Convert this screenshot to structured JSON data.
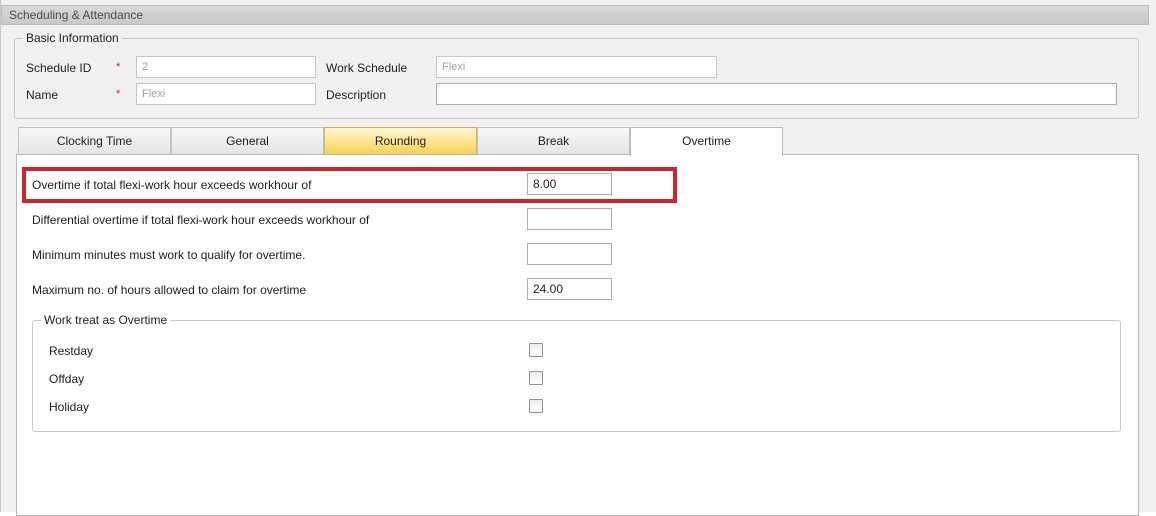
{
  "window": {
    "title": "Scheduling & Attendance"
  },
  "basic_info": {
    "legend": "Basic Information",
    "schedule_id_label": "Schedule ID",
    "schedule_id_required": "*",
    "schedule_id_value": "2",
    "work_schedule_label": "Work Schedule",
    "work_schedule_value": "Flexi",
    "name_label": "Name",
    "name_required": "*",
    "name_value": "Flexi",
    "description_label": "Description",
    "description_value": ""
  },
  "tabs": [
    {
      "label": "Clocking Time"
    },
    {
      "label": "General"
    },
    {
      "label": "Rounding"
    },
    {
      "label": "Break"
    },
    {
      "label": "Overtime"
    }
  ],
  "overtime": {
    "rows": [
      {
        "label": "Overtime if total flexi-work hour exceeds workhour of",
        "value": "8.00"
      },
      {
        "label": "Differential overtime if total flexi-work hour exceeds workhour of",
        "value": ""
      },
      {
        "label": "Minimum minutes must work to qualify for overtime.",
        "value": ""
      },
      {
        "label": "Maximum no. of hours allowed to claim for overtime",
        "value": "24.00"
      }
    ],
    "work_treat": {
      "legend": "Work treat as Overtime",
      "items": [
        {
          "label": "Restday"
        },
        {
          "label": "Offday"
        },
        {
          "label": "Holiday"
        }
      ]
    }
  },
  "colors": {
    "highlight": "#d3222b",
    "required": "#d81f26",
    "hot_tab": "#f7cf4f"
  }
}
